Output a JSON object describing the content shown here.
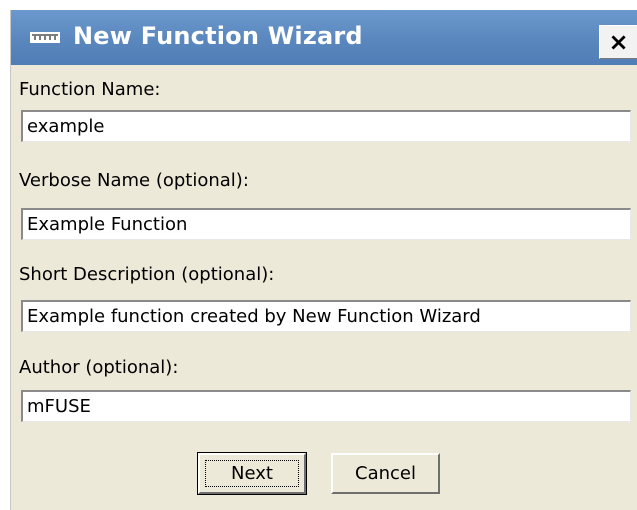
{
  "window": {
    "title": "New Function Wizard",
    "icon": "ruler-icon",
    "close_label": "×",
    "titlebar_color": "#5a87bd"
  },
  "form": {
    "function_name": {
      "label": "Function Name:",
      "value": "example"
    },
    "verbose_name": {
      "label": "Verbose Name (optional):",
      "value": "Example Function"
    },
    "short_description": {
      "label": "Short Description (optional):",
      "value": "Example function created by New Function Wizard"
    },
    "author": {
      "label": "Author (optional):",
      "value": "mFUSE"
    }
  },
  "buttons": {
    "next_label": "Next",
    "cancel_label": "Cancel"
  }
}
